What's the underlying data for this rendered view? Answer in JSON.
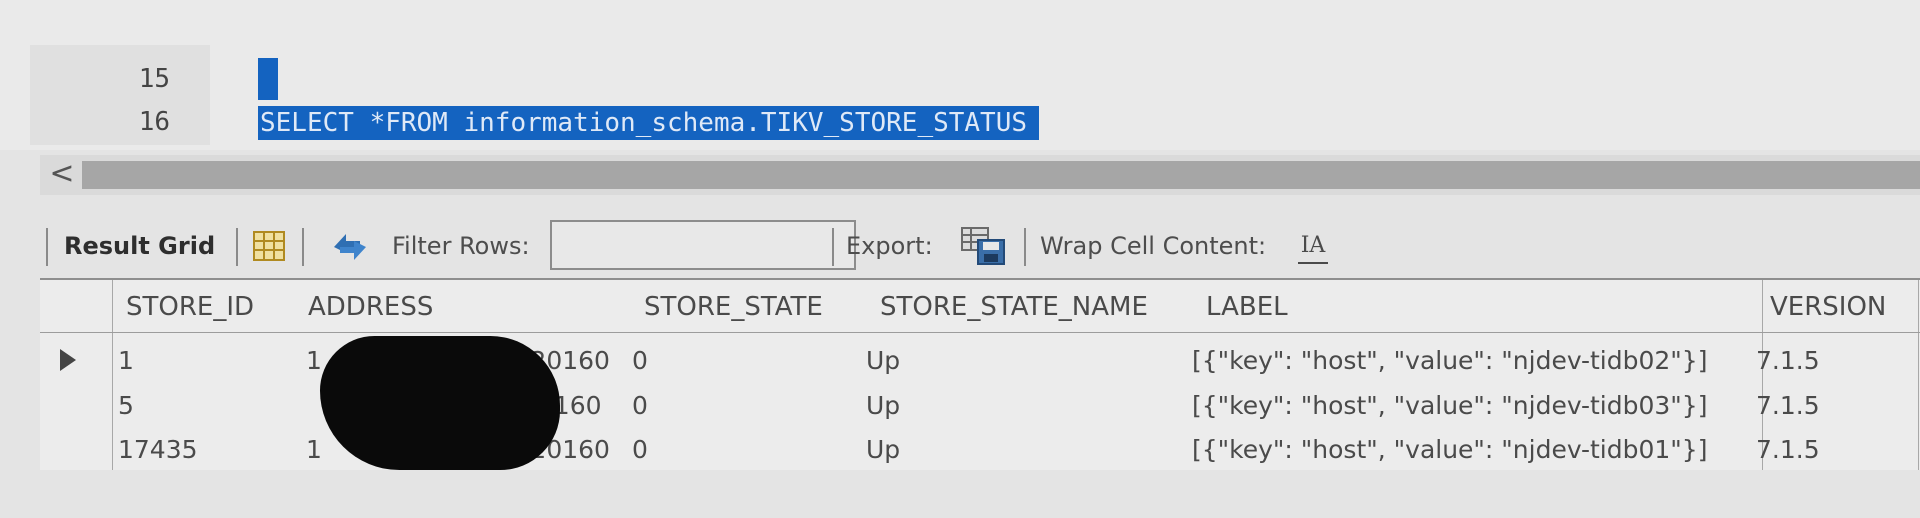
{
  "editor": {
    "partial_line_number": "",
    "lines": [
      {
        "number": "15",
        "text": ""
      },
      {
        "number": "16",
        "text": "SELECT *FROM information_schema.TIKV_STORE_STATUS"
      }
    ]
  },
  "scrollbar": {
    "left_arrow": "<"
  },
  "toolbar": {
    "result_grid_label": "Result Grid",
    "filter_rows_label": "Filter Rows:",
    "filter_rows_value": "",
    "export_label": "Export:",
    "wrap_cell_label": "Wrap Cell Content:",
    "wrap_icon_glyph": "IA",
    "icons": [
      "grid-icon",
      "refresh-icon",
      "export-icon",
      "wrap-cell-icon"
    ],
    "colors": {
      "refresh": "#2f6fb3",
      "grid_icon": "#c9a640",
      "selection": "#1463c0"
    }
  },
  "grid": {
    "columns": [
      "STORE_ID",
      "ADDRESS",
      "STORE_STATE",
      "STORE_STATE_NAME",
      "LABEL",
      "VERSION"
    ],
    "rows": [
      {
        "store_id": "1",
        "address": "1",
        "address_suffix": ":20160",
        "store_state": "0",
        "store_state_name": "Up",
        "label": "[{\"key\": \"host\", \"value\": \"njdev-tidb02\"}]",
        "version": "7.1.5"
      },
      {
        "store_id": "5",
        "address": "",
        "address_suffix": "20160",
        "store_state": "0",
        "store_state_name": "Up",
        "label": "[{\"key\": \"host\", \"value\": \"njdev-tidb03\"}]",
        "version": "7.1.5"
      },
      {
        "store_id": "17435",
        "address": "1",
        "address_suffix": ":20160",
        "store_state": "0",
        "store_state_name": "Up",
        "label": "[{\"key\": \"host\", \"value\": \"njdev-tidb01\"}]",
        "version": "7.1.5"
      }
    ],
    "selected_row": 0
  }
}
